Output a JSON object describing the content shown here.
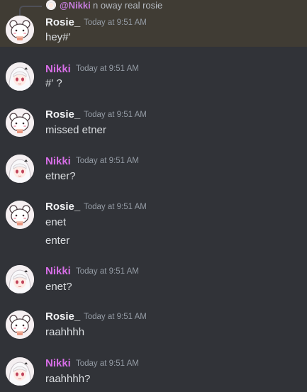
{
  "reply": {
    "name": "@Nikki",
    "text": "n oway real rosie"
  },
  "messages": [
    {
      "user": "Rosie_",
      "time": "Today at 9:51 AM",
      "lines": [
        "hey#'"
      ]
    },
    {
      "user": "Nikki",
      "time": "Today at 9:51 AM",
      "lines": [
        "#' ?"
      ]
    },
    {
      "user": "Rosie_",
      "time": "Today at 9:51 AM",
      "lines": [
        "missed etner"
      ]
    },
    {
      "user": "Nikki",
      "time": "Today at 9:51 AM",
      "lines": [
        "etner?"
      ]
    },
    {
      "user": "Rosie_",
      "time": "Today at 9:51 AM",
      "lines": [
        "enet",
        "enter"
      ]
    },
    {
      "user": "Nikki",
      "time": "Today at 9:51 AM",
      "lines": [
        "enet?"
      ]
    },
    {
      "user": "Rosie_",
      "time": "Today at 9:51 AM",
      "lines": [
        "raahhhh"
      ]
    },
    {
      "user": "Nikki",
      "time": "Today at 9:51 AM",
      "lines": [
        "raahhhh?"
      ]
    }
  ],
  "colors": {
    "background": "#313338",
    "highlight": "#403c34",
    "nikki_name": "#d66ee6",
    "rosie_name": "#f2f3f5",
    "timestamp": "#949ba4",
    "message_text": "#dbdee1"
  }
}
